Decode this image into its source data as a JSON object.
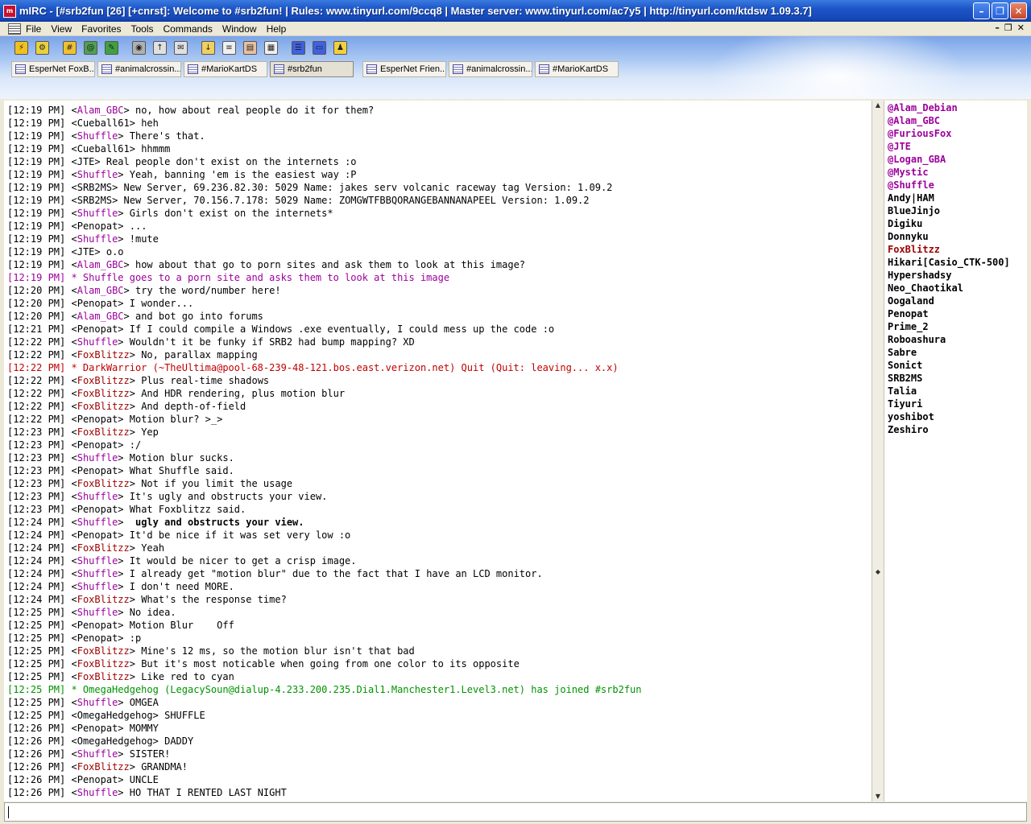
{
  "window": {
    "title": "mIRC - [#srb2fun [26] [+cnrst]: Welcome to #srb2fun! | Rules: www.tinyurl.com/9ccq8 | Master server: www.tinyurl.com/ac7y5 | http://tinyurl.com/ktdsw 1.09.3.7]",
    "app_icon_label": "m",
    "minimize_glyph": "–",
    "maximize_glyph": "❐",
    "close_glyph": "✕"
  },
  "menu": {
    "items": [
      "File",
      "View",
      "Favorites",
      "Tools",
      "Commands",
      "Window",
      "Help"
    ],
    "mdi_minimize": "–",
    "mdi_restore": "❐",
    "mdi_close": "✕"
  },
  "toolbar": {
    "icons": [
      {
        "name": "connect-icon",
        "glyph": "⚡",
        "color": "#f0c020"
      },
      {
        "name": "options-icon",
        "glyph": "⚙",
        "color": "#e8d040"
      },
      {
        "name": "channels-folder-icon",
        "glyph": "#",
        "color": "#f0c030"
      },
      {
        "name": "address-book-icon",
        "glyph": "@",
        "color": "#50a050"
      },
      {
        "name": "script-editor-icon",
        "glyph": "✎",
        "color": "#40a040"
      },
      {
        "name": "colors-icon",
        "glyph": "◉",
        "color": "#b0b0b0"
      },
      {
        "name": "dcc-send-icon",
        "glyph": "↑",
        "color": "#e0e0e0"
      },
      {
        "name": "dcc-chat-icon",
        "glyph": "✉",
        "color": "#e0e0e0"
      },
      {
        "name": "dcc-get-icon",
        "glyph": "↓",
        "color": "#f0d060"
      },
      {
        "name": "notify-list-icon",
        "glyph": "≡",
        "color": "#f0f0f0"
      },
      {
        "name": "logs-icon",
        "glyph": "▤",
        "color": "#e8c0a0"
      },
      {
        "name": "urls-icon",
        "glyph": "▦",
        "color": "#f0f0f0"
      },
      {
        "name": "tile-horizontal-icon",
        "glyph": "☰",
        "color": "#4060e0"
      },
      {
        "name": "tile-vertical-icon",
        "glyph": "▭",
        "color": "#4060e0"
      },
      {
        "name": "help-icon",
        "glyph": "♟",
        "color": "#f0d040"
      }
    ]
  },
  "switchbar": {
    "tabs": [
      "EsperNet FoxB...",
      "#animalcrossin...",
      "#MarioKartDS",
      "#srb2fun",
      "EsperNet Frien...",
      "#animalcrossin...",
      "#MarioKartDS"
    ]
  },
  "chat": {
    "lines": [
      {
        "ts": "[12:19 PM]",
        "nick": "Alam_GBC",
        "text": "no, how about real people do it for them?"
      },
      {
        "ts": "[12:19 PM]",
        "nick": "Cueball61",
        "text": "heh"
      },
      {
        "ts": "[12:19 PM]",
        "nick": "Shuffle",
        "text": "There's that."
      },
      {
        "ts": "[12:19 PM]",
        "nick": "Cueball61",
        "text": "hhmmm"
      },
      {
        "ts": "[12:19 PM]",
        "nick": "JTE",
        "text": "Real people don't exist on the internets :o"
      },
      {
        "ts": "[12:19 PM]",
        "nick": "Shuffle",
        "text": "Yeah, banning 'em is the easiest way :P"
      },
      {
        "ts": "[12:19 PM]",
        "nick": "SRB2MS",
        "text": "New Server, 69.236.82.30: 5029 Name: jakes serv volcanic raceway tag Version: 1.09.2"
      },
      {
        "ts": "[12:19 PM]",
        "nick": "SRB2MS",
        "text": "New Server, 70.156.7.178: 5029 Name: ZOMGWTFBBQORANGEBANNANAPEEL Version: 1.09.2"
      },
      {
        "ts": "[12:19 PM]",
        "nick": "Shuffle",
        "text": "Girls don't exist on the internets*"
      },
      {
        "ts": "[12:19 PM]",
        "nick": "Penopat",
        "text": "..."
      },
      {
        "ts": "[12:19 PM]",
        "nick": "Shuffle",
        "text": "!mute"
      },
      {
        "ts": "[12:19 PM]",
        "nick": "JTE",
        "text": "o.o"
      },
      {
        "ts": "[12:19 PM]",
        "nick": "Alam_GBC",
        "text": "how about that go to porn sites and ask them to look at this image?"
      },
      {
        "ts": "[12:19 PM]",
        "type": "action",
        "text": "* Shuffle goes to a porn site and asks them to look at this image"
      },
      {
        "ts": "[12:20 PM]",
        "nick": "Alam_GBC",
        "text": "try the word/number here!"
      },
      {
        "ts": "[12:20 PM]",
        "nick": "Penopat",
        "text": "I wonder..."
      },
      {
        "ts": "[12:20 PM]",
        "nick": "Alam_GBC",
        "text": "and bot go into forums"
      },
      {
        "ts": "[12:21 PM]",
        "nick": "Penopat",
        "text": "If I could compile a Windows .exe eventually, I could mess up the code :o"
      },
      {
        "ts": "[12:22 PM]",
        "nick": "Shuffle",
        "text": "Wouldn't it be funky if SRB2 had bump mapping? XD"
      },
      {
        "ts": "[12:22 PM]",
        "nick": "FoxBlitzz",
        "text": "No, parallax mapping"
      },
      {
        "ts": "[12:22 PM]",
        "type": "quit",
        "text": "* DarkWarrior (~TheUltima@pool-68-239-48-121.bos.east.verizon.net) Quit (Quit: leaving... x.x)"
      },
      {
        "ts": "[12:22 PM]",
        "nick": "FoxBlitzz",
        "text": "Plus real-time shadows"
      },
      {
        "ts": "[12:22 PM]",
        "nick": "FoxBlitzz",
        "text": "And HDR rendering, plus motion blur"
      },
      {
        "ts": "[12:22 PM]",
        "nick": "FoxBlitzz",
        "text": "And depth-of-field"
      },
      {
        "ts": "[12:22 PM]",
        "nick": "Penopat",
        "text": "Motion blur? >_>"
      },
      {
        "ts": "[12:23 PM]",
        "nick": "FoxBlitzz",
        "text": "Yep"
      },
      {
        "ts": "[12:23 PM]",
        "nick": "Penopat",
        "text": ":/"
      },
      {
        "ts": "[12:23 PM]",
        "nick": "Shuffle",
        "text": "Motion blur sucks."
      },
      {
        "ts": "[12:23 PM]",
        "nick": "Penopat",
        "text": "What Shuffle said."
      },
      {
        "ts": "[12:23 PM]",
        "nick": "FoxBlitzz",
        "text": "Not if you limit the usage"
      },
      {
        "ts": "[12:23 PM]",
        "nick": "Shuffle",
        "text": "It's ugly and obstructs your view."
      },
      {
        "ts": "[12:23 PM]",
        "nick": "Penopat",
        "text": "What Foxblitzz said."
      },
      {
        "ts": "[12:24 PM]",
        "nick": "Shuffle",
        "text": " ugly and obstructs your view.",
        "bold": true
      },
      {
        "ts": "[12:24 PM]",
        "nick": "Penopat",
        "text": "It'd be nice if it was set very low :o"
      },
      {
        "ts": "[12:24 PM]",
        "nick": "FoxBlitzz",
        "text": "Yeah"
      },
      {
        "ts": "[12:24 PM]",
        "nick": "Shuffle",
        "text": "It would be nicer to get a crisp image."
      },
      {
        "ts": "[12:24 PM]",
        "nick": "Shuffle",
        "text": "I already get \"motion blur\" due to the fact that I have an LCD monitor."
      },
      {
        "ts": "[12:24 PM]",
        "nick": "Shuffle",
        "text": "I don't need MORE."
      },
      {
        "ts": "[12:24 PM]",
        "nick": "FoxBlitzz",
        "text": "What's the response time?"
      },
      {
        "ts": "[12:25 PM]",
        "nick": "Shuffle",
        "text": "No idea."
      },
      {
        "ts": "[12:25 PM]",
        "nick": "Penopat",
        "text": "Motion Blur    Off"
      },
      {
        "ts": "[12:25 PM]",
        "nick": "Penopat",
        "text": ":p"
      },
      {
        "ts": "[12:25 PM]",
        "nick": "FoxBlitzz",
        "text": "Mine's 12 ms, so the motion blur isn't that bad"
      },
      {
        "ts": "[12:25 PM]",
        "nick": "FoxBlitzz",
        "text": "But it's most noticable when going from one color to its opposite"
      },
      {
        "ts": "[12:25 PM]",
        "nick": "FoxBlitzz",
        "text": "Like red to cyan"
      },
      {
        "ts": "[12:25 PM]",
        "type": "join",
        "text": "* OmegaHedgehog (LegacySoun@dialup-4.233.200.235.Dial1.Manchester1.Level3.net) has joined #srb2fun"
      },
      {
        "ts": "[12:25 PM]",
        "nick": "Shuffle",
        "text": "OMGEA"
      },
      {
        "ts": "[12:25 PM]",
        "nick": "OmegaHedgehog",
        "text": "SHUFFLE"
      },
      {
        "ts": "[12:26 PM]",
        "nick": "Penopat",
        "text": "MOMMY"
      },
      {
        "ts": "[12:26 PM]",
        "nick": "OmegaHedgehog",
        "text": "DADDY"
      },
      {
        "ts": "[12:26 PM]",
        "nick": "Shuffle",
        "text": "SISTER!"
      },
      {
        "ts": "[12:26 PM]",
        "nick": "FoxBlitzz",
        "text": "GRANDMA!"
      },
      {
        "ts": "[12:26 PM]",
        "nick": "Penopat",
        "text": "UNCLE"
      },
      {
        "ts": "[12:26 PM]",
        "nick": "Shuffle",
        "text": "HO THAT I RENTED LAST NIGHT"
      }
    ],
    "nick_colors": {
      "Alam_GBC": "purple",
      "Shuffle": "purple",
      "FoxBlitzz": "red"
    },
    "scroll_up_glyph": "▲",
    "scroll_down_glyph": "▼",
    "scroll_grip_glyph": "◆"
  },
  "nicklist": {
    "items": [
      {
        "name": "@Alam_Debian",
        "style": "op"
      },
      {
        "name": "@Alam_GBC",
        "style": "op"
      },
      {
        "name": "@FuriousFox",
        "style": "op"
      },
      {
        "name": "@JTE",
        "style": "op"
      },
      {
        "name": "@Logan_GBA",
        "style": "op"
      },
      {
        "name": "@Mystic",
        "style": "op"
      },
      {
        "name": "@Shuffle",
        "style": "op"
      },
      {
        "name": "Andy|HAM",
        "style": "normal"
      },
      {
        "name": "BlueJinjo",
        "style": "normal"
      },
      {
        "name": "Digiku",
        "style": "normal"
      },
      {
        "name": "Donnyku",
        "style": "normal"
      },
      {
        "name": "FoxBlitzz",
        "style": "red"
      },
      {
        "name": "Hikari[Casio_CTK-500]",
        "style": "normal"
      },
      {
        "name": "Hypershadsy",
        "style": "normal"
      },
      {
        "name": "Neo_Chaotikal",
        "style": "normal"
      },
      {
        "name": "Oogaland",
        "style": "normal"
      },
      {
        "name": "Penopat",
        "style": "normal"
      },
      {
        "name": "Prime_2",
        "style": "normal"
      },
      {
        "name": "Roboashura",
        "style": "normal"
      },
      {
        "name": "Sabre",
        "style": "normal"
      },
      {
        "name": "Sonict",
        "style": "normal"
      },
      {
        "name": "SRB2MS",
        "style": "normal"
      },
      {
        "name": "Talia",
        "style": "normal"
      },
      {
        "name": "Tiyuri",
        "style": "normal"
      },
      {
        "name": "yoshibot",
        "style": "normal"
      },
      {
        "name": "Zeshiro",
        "style": "normal"
      }
    ]
  },
  "editbox": {
    "value": ""
  }
}
